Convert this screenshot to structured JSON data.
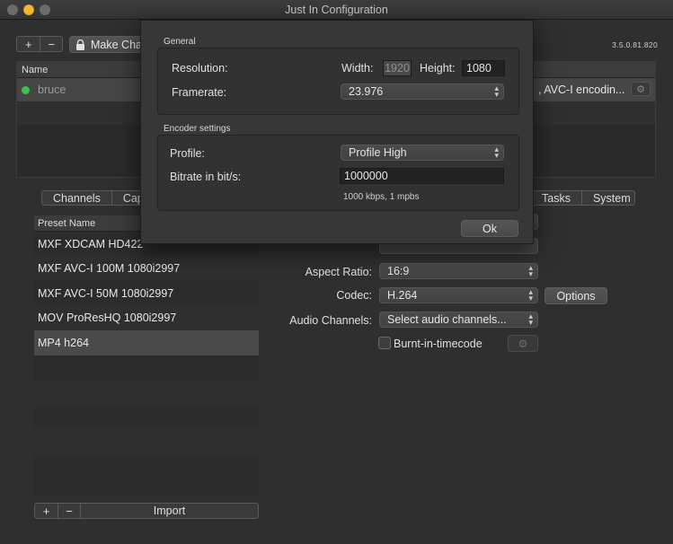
{
  "window": {
    "title": "Just In Configuration"
  },
  "toolbar": {
    "add": "+",
    "remove": "−",
    "make_button": "Make Cha",
    "version": "3.5.0.81.820"
  },
  "users": {
    "header": "Name",
    "rows": [
      {
        "name": "bruce",
        "encoding": ", AVC-I encodin..."
      }
    ]
  },
  "tabs": {
    "left": [
      "Channels",
      "Capt"
    ],
    "right": [
      "Tasks",
      "System"
    ]
  },
  "presets": {
    "header": "Preset Name",
    "items": [
      "MXF XDCAM HD422",
      "MXF AVC-I 100M 1080i2997",
      "MXF AVC-I 50M 1080i2997",
      "MOV ProResHQ 1080i2997",
      "MP4 h264"
    ],
    "selected": "MP4 h264",
    "add": "+",
    "remove": "−",
    "import": "Import"
  },
  "form": {
    "aspect_label": "Aspect Ratio:",
    "aspect_value": "16:9",
    "codec_label": "Codec:",
    "codec_value": "H.264",
    "options_button": "Options",
    "audio_label": "Audio Channels:",
    "audio_value": "Select audio channels...",
    "burnin_label": "Burnt-in-timecode"
  },
  "modal": {
    "general_title": "General",
    "resolution_label": "Resolution:",
    "width_label": "Width:",
    "width_value": "1920",
    "height_label": "Height:",
    "height_value": "1080",
    "framerate_label": "Framerate:",
    "framerate_value": "23.976",
    "encoder_title": "Encoder settings",
    "profile_label": "Profile:",
    "profile_value": "Profile High",
    "bitrate_label": "Bitrate in bit/s:",
    "bitrate_value": "1000000",
    "bitrate_hint": "1000 kbps, 1 mpbs",
    "ok_button": "Ok"
  }
}
